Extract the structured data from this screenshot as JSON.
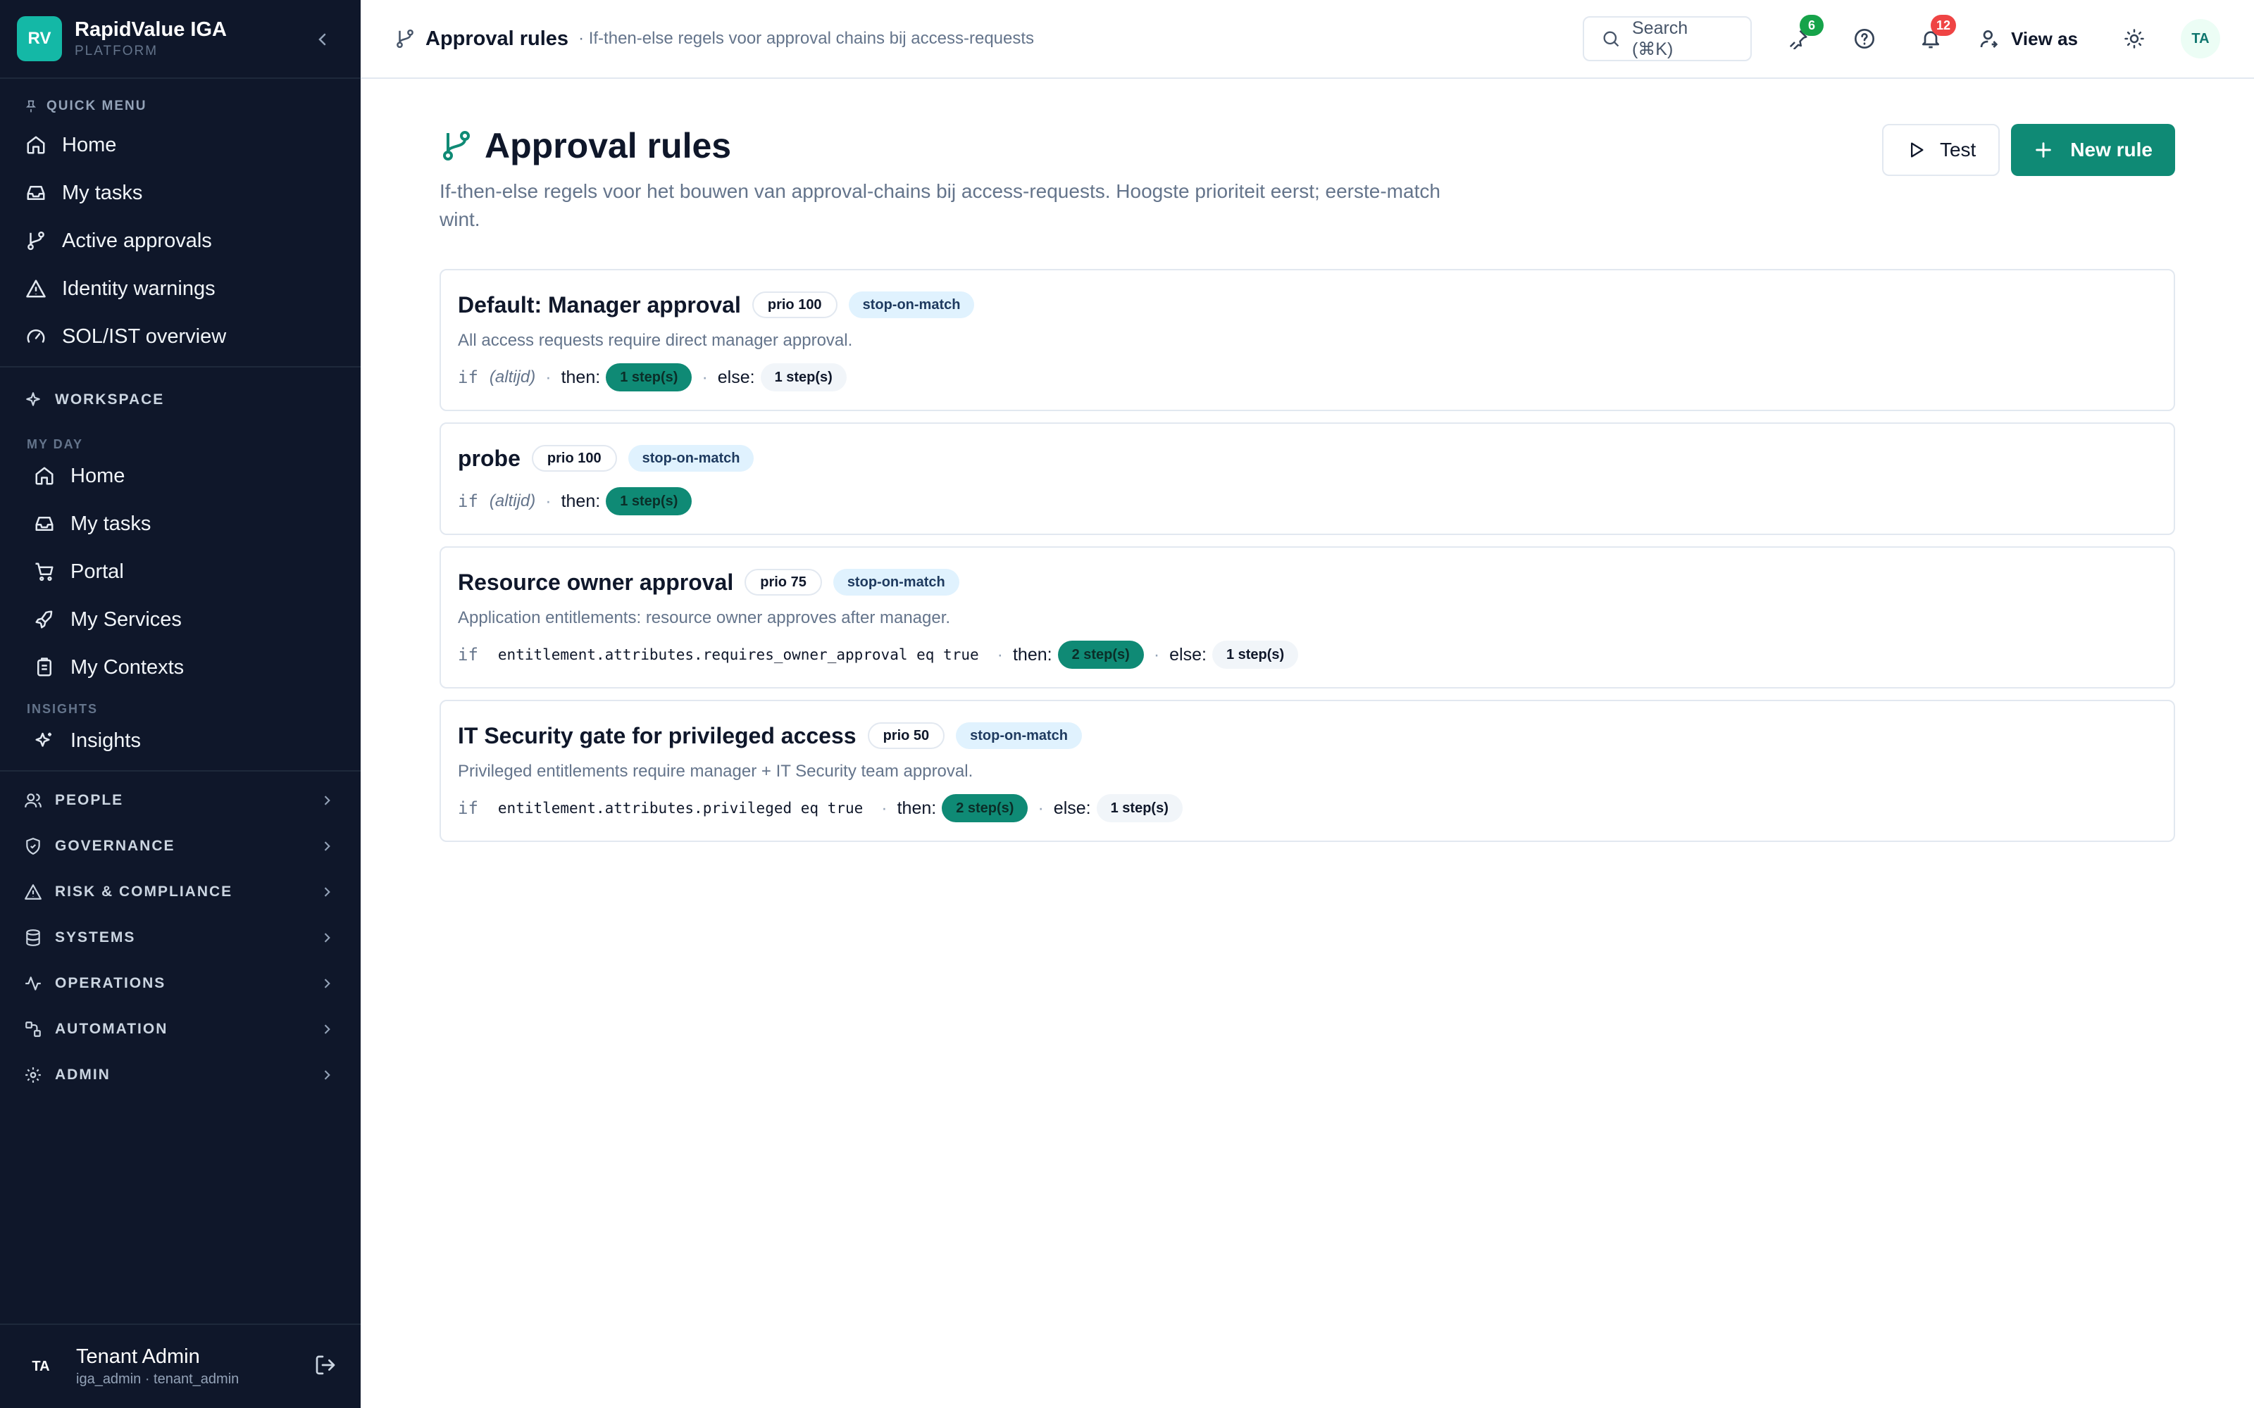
{
  "brand": {
    "logo": "RV",
    "name": "RapidValue IGA",
    "sub": "PLATFORM"
  },
  "sidebar": {
    "quick_menu_label": "QUICK MENU",
    "quick_items": [
      {
        "label": "Home",
        "icon": "home-icon"
      },
      {
        "label": "My tasks",
        "icon": "inbox-icon"
      },
      {
        "label": "Active approvals",
        "icon": "git-branch-icon"
      },
      {
        "label": "Identity warnings",
        "icon": "warning-icon"
      },
      {
        "label": "SOL/IST overview",
        "icon": "gauge-icon"
      }
    ],
    "workspace_label": "WORKSPACE",
    "my_day_label": "MY DAY",
    "my_day_items": [
      {
        "label": "Home",
        "icon": "home-icon"
      },
      {
        "label": "My tasks",
        "icon": "inbox-icon"
      },
      {
        "label": "Portal",
        "icon": "cart-icon"
      },
      {
        "label": "My Services",
        "icon": "rocket-icon"
      },
      {
        "label": "My Contexts",
        "icon": "clipboard-icon"
      }
    ],
    "insights_label": "INSIGHTS",
    "insights_items": [
      {
        "label": "Insights",
        "icon": "sparkle-icon"
      }
    ],
    "groups": [
      {
        "label": "PEOPLE",
        "icon": "people-icon"
      },
      {
        "label": "GOVERNANCE",
        "icon": "shield-icon"
      },
      {
        "label": "RISK & COMPLIANCE",
        "icon": "warning-icon"
      },
      {
        "label": "SYSTEMS",
        "icon": "database-icon"
      },
      {
        "label": "OPERATIONS",
        "icon": "activity-icon"
      },
      {
        "label": "AUTOMATION",
        "icon": "workflow-icon"
      },
      {
        "label": "ADMIN",
        "icon": "gear-icon"
      }
    ],
    "user": {
      "initials": "TA",
      "name": "Tenant Admin",
      "role": "iga_admin · tenant_admin"
    }
  },
  "topbar": {
    "title": "Approval rules",
    "subtitle": "· If-then-else regels voor approval chains bij access-requests",
    "search_label": "Search (⌘K)",
    "pinned_count": "6",
    "notification_count": "12",
    "view_as_label": "View as",
    "avatar": "TA"
  },
  "page": {
    "title": "Approval rules",
    "description": "If-then-else regels voor het bouwen van approval-chains bij access-requests. Hoogste prioriteit eerst; eerste-match wint.",
    "test_label": "Test",
    "new_rule_label": "New rule"
  },
  "rules": [
    {
      "name": "Default: Manager approval",
      "priority": "prio 100",
      "mode": "stop-on-match",
      "description": "All access requests require direct manager approval.",
      "if_kw": "if",
      "condition": "(altijd)",
      "then_label": "then:",
      "then_steps": "1 step(s)",
      "else_label": "else:",
      "else_steps": "1 step(s)"
    },
    {
      "name": "probe",
      "priority": "prio 100",
      "mode": "stop-on-match",
      "if_kw": "if",
      "condition": "(altijd)",
      "then_label": "then:",
      "then_steps": "1 step(s)"
    },
    {
      "name": "Resource owner approval",
      "priority": "prio 75",
      "mode": "stop-on-match",
      "description": "Application entitlements: resource owner approves after manager.",
      "if_kw": "if",
      "condition": "entitlement.attributes.requires_owner_approval eq true",
      "then_label": "then:",
      "then_steps": "2 step(s)",
      "else_label": "else:",
      "else_steps": "1 step(s)"
    },
    {
      "name": "IT Security gate for privileged access",
      "priority": "prio 50",
      "mode": "stop-on-match",
      "description": "Privileged entitlements require manager + IT Security team approval.",
      "if_kw": "if",
      "condition": "entitlement.attributes.privileged eq true",
      "then_label": "then:",
      "then_steps": "2 step(s)",
      "else_label": "else:",
      "else_steps": "1 step(s)"
    }
  ],
  "colors": {
    "sidebar_bg": "#0f172a",
    "accent": "#0f8a75",
    "pin_badge": "#16a34a",
    "notif_badge": "#ef4444"
  }
}
